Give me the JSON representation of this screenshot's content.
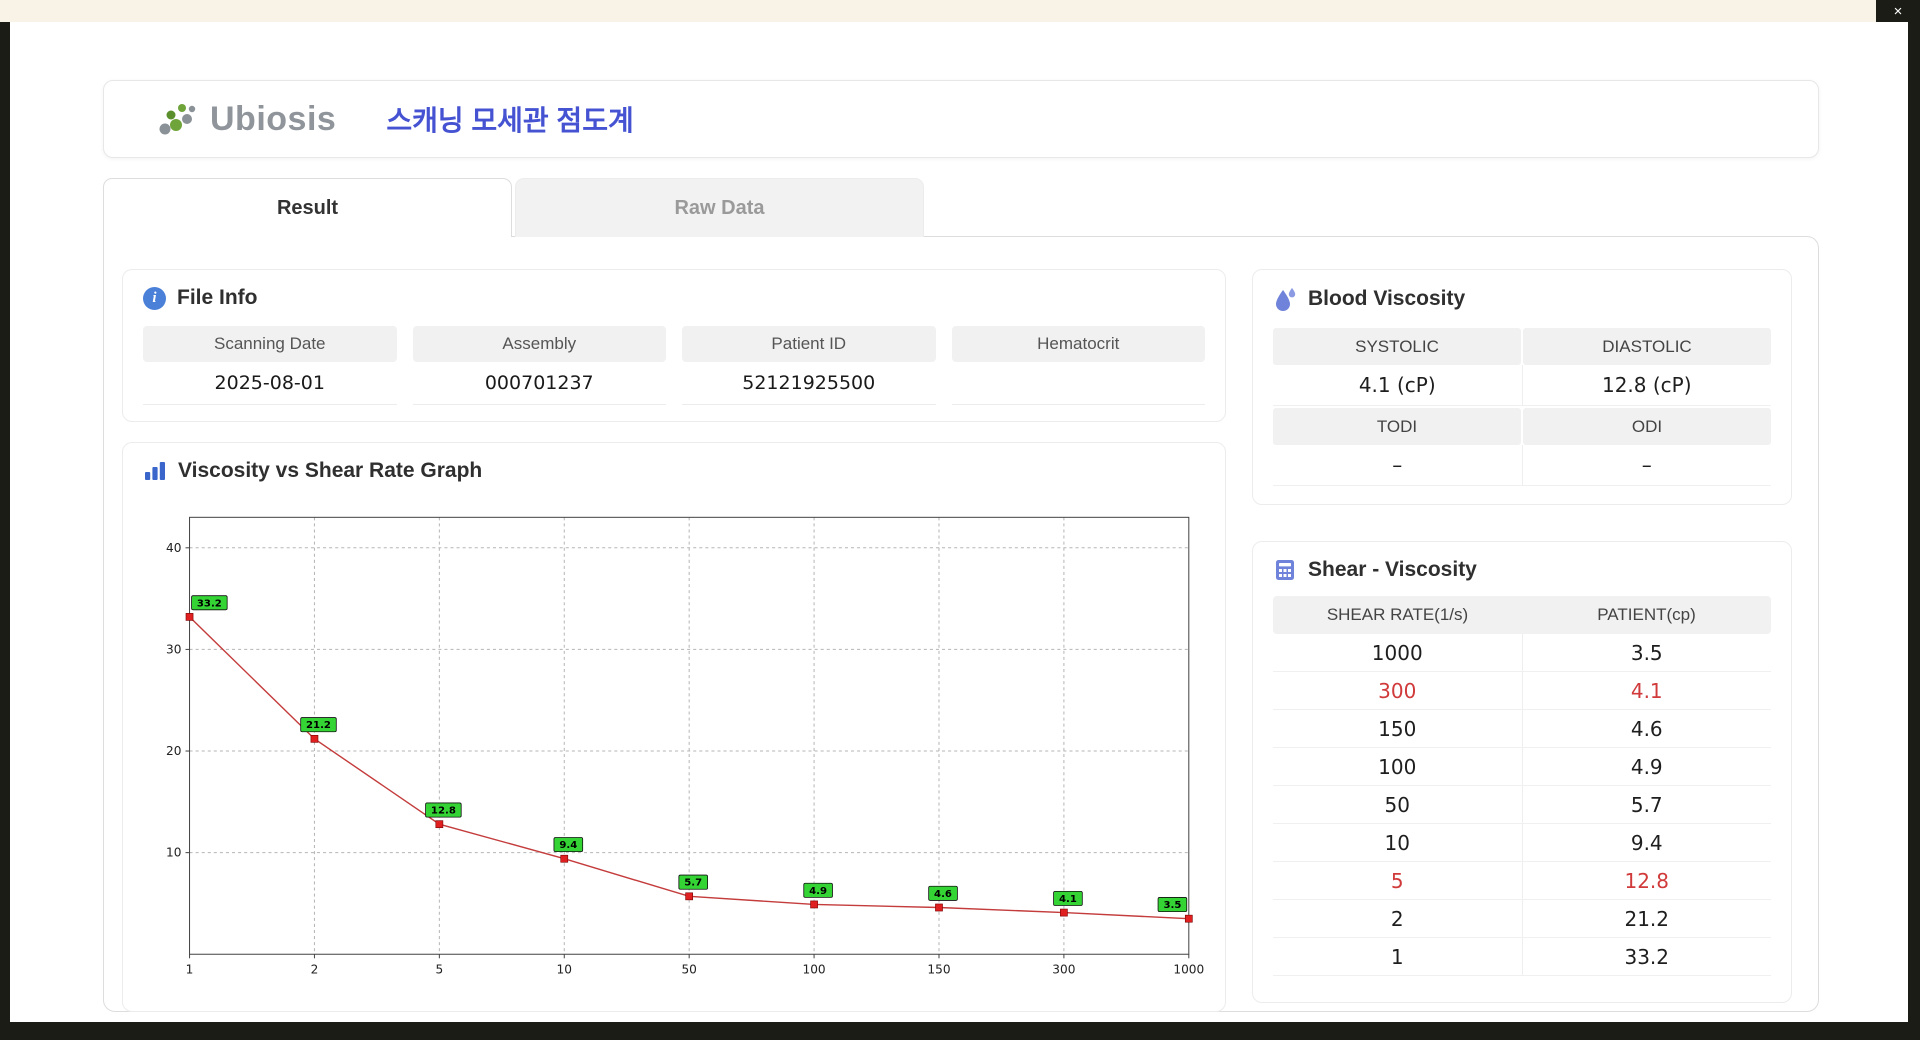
{
  "window": {
    "close_label": "×"
  },
  "header": {
    "logo_text": "Ubiosis",
    "title": "스캐닝 모세관 점도계"
  },
  "icons": {
    "info": "i",
    "close": "×"
  },
  "tabs": {
    "result": "Result",
    "raw_data": "Raw Data"
  },
  "file_info": {
    "title": "File Info",
    "fields": [
      {
        "label": "Scanning Date",
        "value": "2025-08-01"
      },
      {
        "label": "Assembly",
        "value": "000701237"
      },
      {
        "label": "Patient ID",
        "value": "52121925500"
      },
      {
        "label": "Hematocrit",
        "value": ""
      }
    ]
  },
  "blood_viscosity": {
    "title": "Blood Viscosity",
    "systolic_label": "SYSTOLIC",
    "systolic_value": "4.1 (cP)",
    "diastolic_label": "DIASTOLIC",
    "diastolic_value": "12.8 (cP)",
    "todi_label": "TODI",
    "todi_value": "–",
    "odi_label": "ODI",
    "odi_value": "–"
  },
  "graph": {
    "title": "Viscosity vs Shear Rate Graph"
  },
  "chart_data": {
    "type": "line",
    "title": "Viscosity vs Shear Rate Graph",
    "x": [
      "1",
      "2",
      "5",
      "10",
      "50",
      "100",
      "150",
      "300",
      "1000"
    ],
    "x_scale": "category",
    "values": [
      33.2,
      21.2,
      12.8,
      9.4,
      5.7,
      4.9,
      4.6,
      4.1,
      3.5
    ],
    "point_labels": [
      "33.2",
      "21.2",
      "12.8",
      "9.4",
      "5.7",
      "4.9",
      "4.6",
      "4.1",
      "3.5"
    ],
    "xlabel": "",
    "ylabel": "",
    "ylim": [
      0,
      43
    ],
    "yticks": [
      10,
      20,
      30,
      40
    ],
    "grid": true,
    "legend": false,
    "line_color": "#c43c3c",
    "marker_color": "#e02020",
    "label_bg": "#35d435"
  },
  "shear_table": {
    "title": "Shear - Viscosity",
    "headers": [
      "SHEAR RATE(1/s)",
      "PATIENT(cp)"
    ],
    "rows": [
      {
        "shear": "1000",
        "patient": "3.5",
        "highlight": false
      },
      {
        "shear": "300",
        "patient": "4.1",
        "highlight": true
      },
      {
        "shear": "150",
        "patient": "4.6",
        "highlight": false
      },
      {
        "shear": "100",
        "patient": "4.9",
        "highlight": false
      },
      {
        "shear": "50",
        "patient": "5.7",
        "highlight": false
      },
      {
        "shear": "10",
        "patient": "9.4",
        "highlight": false
      },
      {
        "shear": "5",
        "patient": "12.8",
        "highlight": true
      },
      {
        "shear": "2",
        "patient": "21.2",
        "highlight": false
      },
      {
        "shear": "1",
        "patient": "33.2",
        "highlight": false
      }
    ]
  }
}
